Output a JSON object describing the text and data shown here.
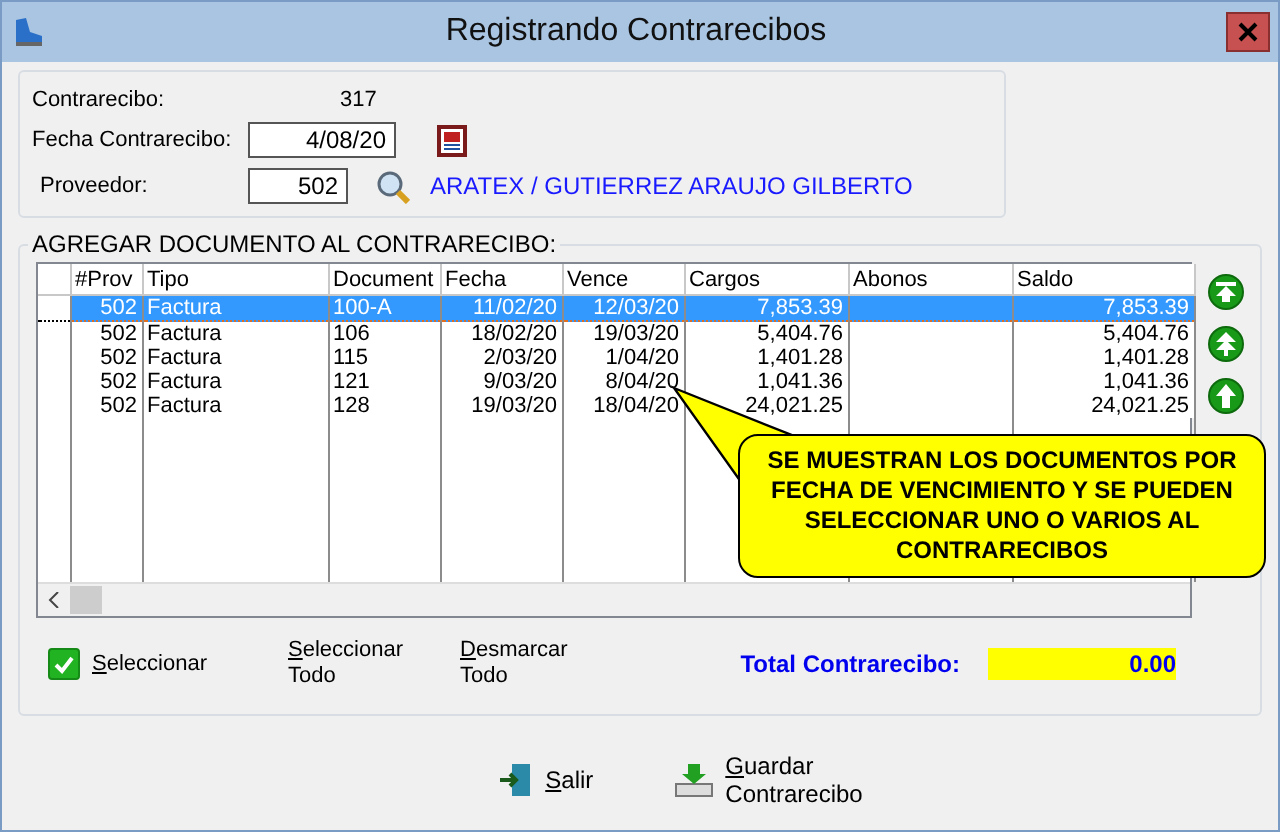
{
  "window": {
    "title": "Registrando Contrarecibos"
  },
  "header": {
    "contrarecibo_label": "Contrarecibo:",
    "contrarecibo_value": "317",
    "fecha_label": "Fecha Contrarecibo:",
    "fecha_value": "4/08/20",
    "proveedor_label": "Proveedor:",
    "proveedor_value": "502",
    "proveedor_name": "ARATEX / GUTIERREZ ARAUJO GILBERTO"
  },
  "grid": {
    "title": "AGREGAR DOCUMENTO AL CONTRARECIBO:",
    "columns": [
      {
        "label": "#Prov"
      },
      {
        "label": "Tipo"
      },
      {
        "label": "Document"
      },
      {
        "label": "Fecha"
      },
      {
        "label": "Vence"
      },
      {
        "label": "Cargos"
      },
      {
        "label": "Abonos"
      },
      {
        "label": "Saldo"
      }
    ],
    "rows": [
      {
        "selected": true,
        "cells": [
          "502",
          "Factura",
          "100-A",
          "11/02/20",
          "12/03/20",
          "7,853.39",
          "",
          "7,853.39"
        ]
      },
      {
        "selected": false,
        "cells": [
          "502",
          "Factura",
          "106",
          "18/02/20",
          "19/03/20",
          "5,404.76",
          "",
          "5,404.76"
        ]
      },
      {
        "selected": false,
        "cells": [
          "502",
          "Factura",
          "115",
          "2/03/20",
          "1/04/20",
          "1,401.28",
          "",
          "1,401.28"
        ]
      },
      {
        "selected": false,
        "cells": [
          "502",
          "Factura",
          "121",
          "9/03/20",
          "8/04/20",
          "1,041.36",
          "",
          "1,041.36"
        ]
      },
      {
        "selected": false,
        "cells": [
          "502",
          "Factura",
          "128",
          "19/03/20",
          "18/04/20",
          "24,021.25",
          "",
          "24,021.25"
        ]
      }
    ]
  },
  "callout": "SE MUESTRAN LOS DOCUMENTOS POR FECHA DE VENCIMIENTO Y SE PUEDEN SELECCIONAR UNO O VARIOS AL CONTRARECIBOS",
  "selection": {
    "checkbox_label": "Seleccionar",
    "checked": true,
    "select_all": [
      "Seleccionar",
      "Todo"
    ],
    "deselect_all": [
      "Desmarcar",
      "Todo"
    ]
  },
  "total": {
    "label": "Total Contrarecibo:",
    "value": "0.00"
  },
  "buttons": [
    {
      "kind": "exit",
      "label": [
        "Salir"
      ]
    },
    {
      "kind": "save",
      "label": [
        "Guardar",
        "Contrarecibo"
      ]
    }
  ]
}
